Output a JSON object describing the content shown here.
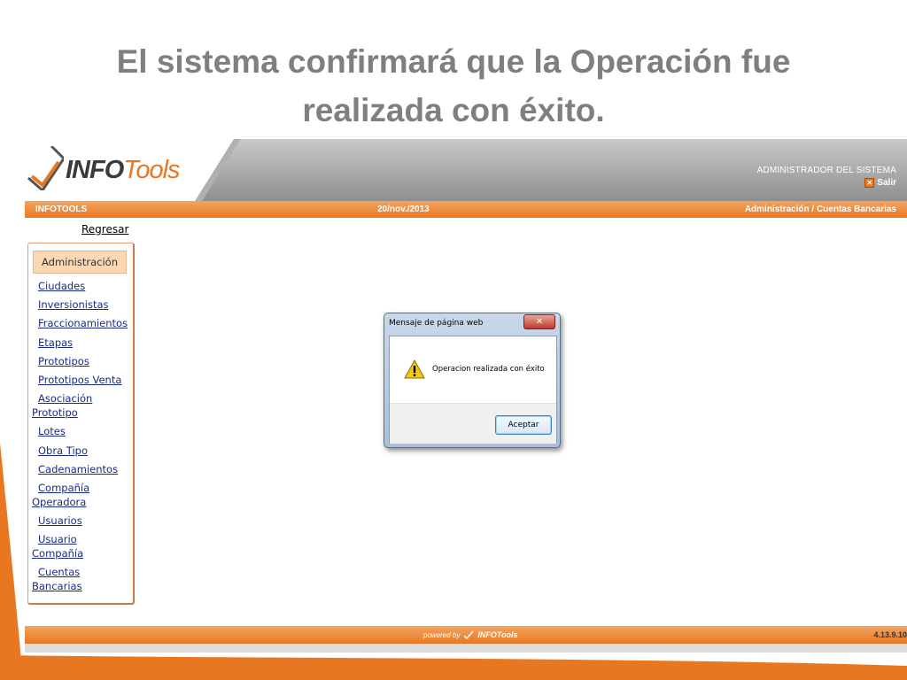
{
  "slide": {
    "title_line1": "El sistema confirmará que la Operación fue",
    "title_line2": "realizada con éxito."
  },
  "header": {
    "logo_info": "INFO",
    "logo_tools": "Tools",
    "user_label": "ADMINISTRADOR DEL SISTEMA",
    "logout_label": "Salir"
  },
  "status_bar": {
    "app_name": "INFOTOOLS",
    "date": "20/nov./2013",
    "breadcrumb": "Administración / Cuentas Bancarias"
  },
  "nav": {
    "back_label": "Regresar",
    "menu_header": "Administración",
    "items": [
      "Ciudades",
      "Inversionistas",
      "Fraccionamientos",
      "Etapas",
      "Prototipos",
      "Prototipos Venta",
      "Asociación Prototipo",
      "Lotes",
      "Obra Tipo",
      "Cadenamientos",
      "Compañía Operadora",
      "Usuarios",
      "Usuario Compañía",
      "Cuentas Bancarias"
    ]
  },
  "dialog": {
    "title": "Mensaje de página web",
    "message": "Operacion realizada con éxito",
    "ok_label": "Aceptar",
    "close_symbol": "✕",
    "icon": "warning-icon"
  },
  "footer": {
    "powered_by": "powered by",
    "powered_brand": "INFOTools",
    "version": "4.13.9.10"
  },
  "colors": {
    "accent_orange": "#e87722",
    "title_gray": "#7f7f7f",
    "link_blue": "#1a2a88"
  }
}
